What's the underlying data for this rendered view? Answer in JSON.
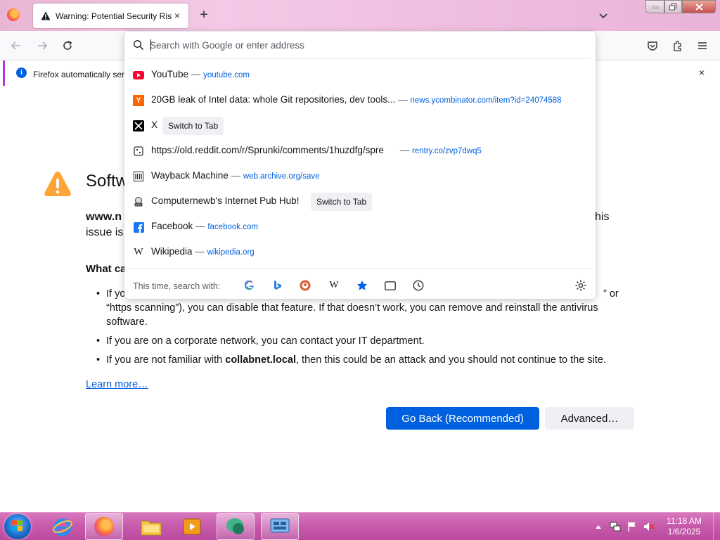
{
  "browser": {
    "active_tab_title": "Warning: Potential Security Risk",
    "tab_close_glyph": "×",
    "new_tab_glyph": "+"
  },
  "notification": {
    "text": "Firefox automatically sen",
    "close_glyph": "×"
  },
  "page": {
    "title": "Softw",
    "lead_host": "www.n",
    "lead_line1_end": "his",
    "lead_line2": "issue is",
    "what_heading": "What ca",
    "bullet1_start": "If yo",
    "bullet1_end": "” or",
    "bullet1_rest": "“https scanning”), you can disable that feature. If that doesn’t work, you can remove and reinstall the antivirus software.",
    "bullet2": "If you are on a corporate network, you can contact your IT department.",
    "bullet3_pre": "If you are not familiar with ",
    "bullet3_host": "collabnet.local",
    "bullet3_post": ", then this could be an attack and you should not continue to the site.",
    "learn_more": "Learn more…",
    "go_back_button": "Go Back (Recommended)",
    "advanced_button": "Advanced…"
  },
  "urlbar": {
    "placeholder": "Search with Google or enter address",
    "results": [
      {
        "icon": "youtube-icon",
        "title": "YouTube",
        "dash": "—",
        "url": "youtube.com"
      },
      {
        "icon": "ycombinator-icon",
        "icon_glyph": "Y",
        "title": "20GB leak of Intel data: whole Git repositories, dev tools...",
        "dash": "—",
        "url": "news.ycombinator.com/item?id=24074588"
      },
      {
        "icon": "x-icon",
        "title": "X",
        "switch": "Switch to Tab"
      },
      {
        "icon": "generic-page-icon",
        "title": "https://old.reddit.com/r/Sprunki/comments/1huzdfg/spre",
        "dash": "—",
        "url": "rentry.co/zvp7dwq5"
      },
      {
        "icon": "wayback-icon",
        "title": "Wayback Machine",
        "dash": "—",
        "url": "web.archive.org/save"
      },
      {
        "icon": "pub-hub-icon",
        "title": "Computernewb's Internet Pub Hub!",
        "switch": "Switch to Tab"
      },
      {
        "icon": "facebook-icon",
        "title": "Facebook",
        "dash": "—",
        "url": "facebook.com"
      },
      {
        "icon": "wikipedia-icon",
        "icon_glyph": "W",
        "title": "Wikipedia",
        "dash": "—",
        "url": "wikipedia.org"
      }
    ],
    "oneoff_label": "This time, search with:",
    "oneoff_engines": [
      "google-icon",
      "bing-icon",
      "duckduckgo-icon",
      "wikipedia-icon",
      "bookmarks-star-icon",
      "tabs-icon",
      "history-icon"
    ],
    "wikipedia_glyph": "W"
  },
  "taskbar": {
    "time": "11:18 AM",
    "date": "1/6/2025"
  },
  "colors": {
    "accent_blue": "#0061e0",
    "link_blue": "#0060df",
    "warning_orange": "#ffa436",
    "taskbar_pink": "#c75aab"
  }
}
